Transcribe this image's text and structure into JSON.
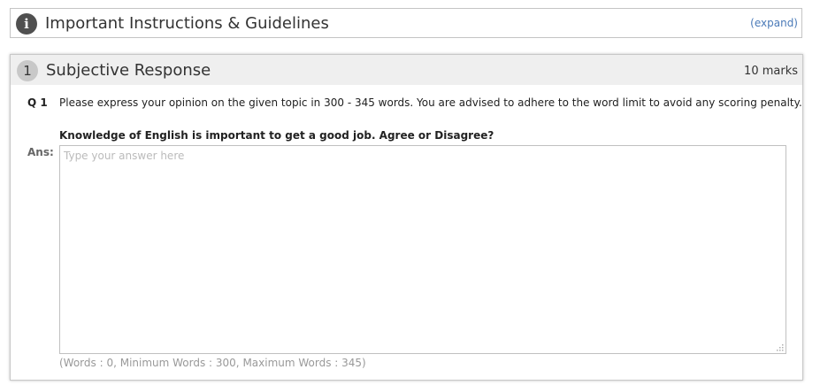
{
  "instructions": {
    "icon": "info-icon",
    "icon_glyph": "i",
    "title": "Important Instructions & Guidelines",
    "expand_label": "(expand)"
  },
  "section": {
    "number": "1",
    "title": "Subjective Response",
    "marks": "10 marks"
  },
  "question": {
    "label": "Q 1",
    "text": "Please express your opinion on the given topic in 300 - 345 words. You are advised to adhere to the word limit to avoid any scoring penalty.",
    "topic": "Knowledge of English is important to get a good job. Agree or Disagree?"
  },
  "answer": {
    "label": "Ans:",
    "placeholder": "Type your answer here",
    "value": "",
    "word_count_text": "(Words : 0, Minimum Words : 300, Maximum Words : 345)"
  },
  "colors": {
    "link": "#4a7ab8",
    "header_bg": "#efefef",
    "info_icon_bg": "#505050"
  }
}
